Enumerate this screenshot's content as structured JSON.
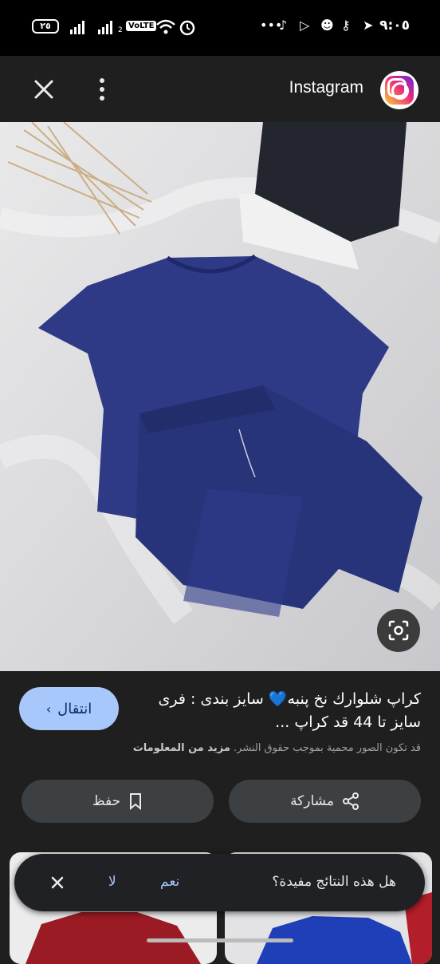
{
  "status_bar": {
    "time": "٩:٠٥",
    "battery": "٢٥",
    "network_label": "VoLTE",
    "sim_index": "2"
  },
  "app_bar": {
    "close_icon": "close-icon",
    "more_icon": "more-vertical-icon",
    "brand": "Instagram",
    "brand_logo_icon": "instagram-logo-icon"
  },
  "result": {
    "visit_label": "انتقال",
    "title": "كراپ شلوارك نخ پنبه💙 سايز بندى : فرى سايز تا 44 قد كراپ ...",
    "copyright_text": "قد تكون الصور محمية بموجب حقوق النشر.",
    "more_info_label": "مزيد من المعلومات",
    "share_label": "مشاركة",
    "save_label": "حفظ"
  },
  "feedback": {
    "question": "هل هذه النتائج مفيدة؟",
    "yes_label": "نعم",
    "no_label": "لا"
  },
  "colors": {
    "background": "#1f1f1f",
    "visit_button": "#a8c7fa",
    "pill_button": "#3c4043",
    "yes_no_text": "#a8c7fa"
  }
}
